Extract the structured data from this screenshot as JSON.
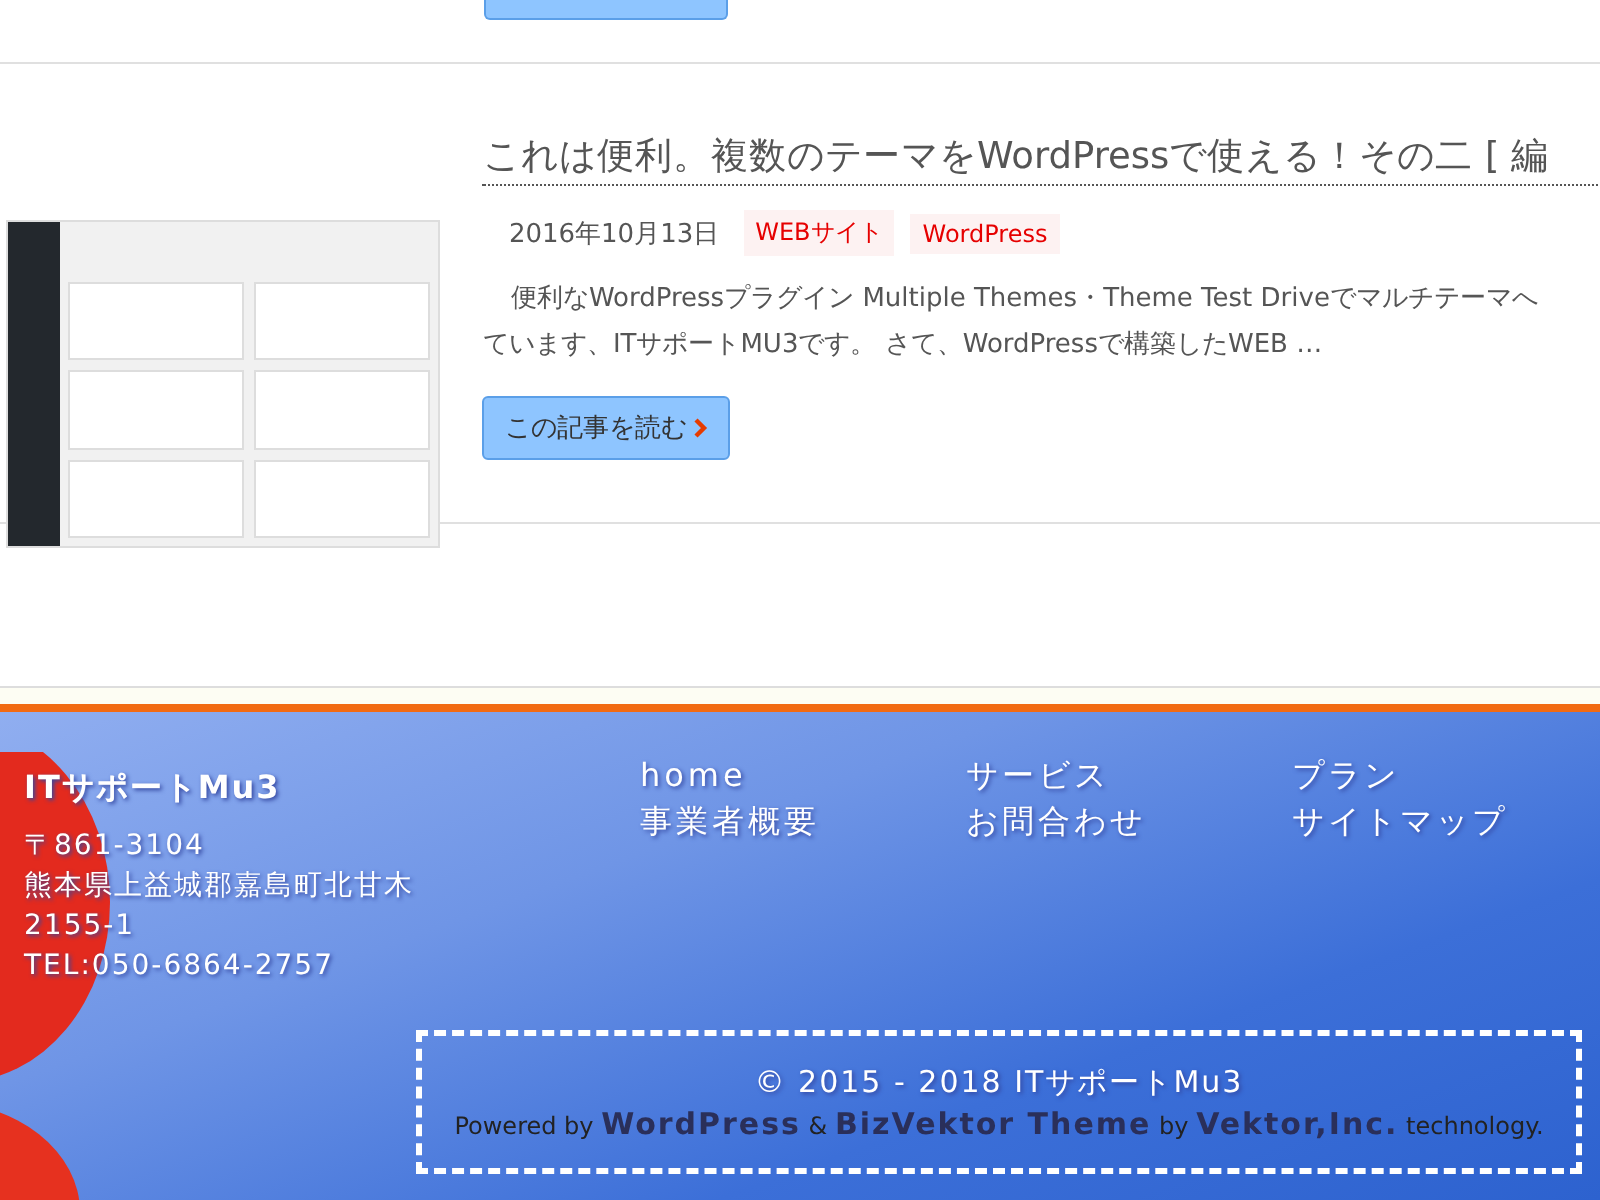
{
  "previous_post": {
    "read_more_cut": true
  },
  "post": {
    "title": "これは便利。複数のテーマをWordPressで使える！その二 [ 編",
    "date": "2016年10月13日",
    "tags": [
      "WEBサイト",
      "WordPress"
    ],
    "excerpt_lines": [
      "便利なWordPressプラグイン Multiple Themes・Theme Test Driveでマルチテーマへ",
      "ています、ITサポートMU3です。 さて、WordPressで構築したWEB …"
    ],
    "read_more": "この記事を読む"
  },
  "footer": {
    "site_name": "ITサポートMu3",
    "address_lines": [
      "〒861-3104",
      "熊本県上益城郡嘉島町北甘木",
      "2155-1",
      "TEL:050-6864-2757"
    ],
    "nav": [
      "home",
      "サービス",
      "プラン",
      "事業者概要",
      "お問合わせ",
      "サイトマップ"
    ],
    "copyright": "© 2015 - 2018  ITサポートMu3",
    "powered": [
      {
        "kind": "text",
        "text": "Powered by "
      },
      {
        "kind": "link",
        "text": "WordPress"
      },
      {
        "kind": "text",
        "text": " & "
      },
      {
        "kind": "link",
        "text": "BizVektor Theme"
      },
      {
        "kind": "text",
        "text": " by "
      },
      {
        "kind": "link",
        "text": "Vektor,Inc."
      },
      {
        "kind": "text",
        "text": " technology."
      }
    ]
  }
}
